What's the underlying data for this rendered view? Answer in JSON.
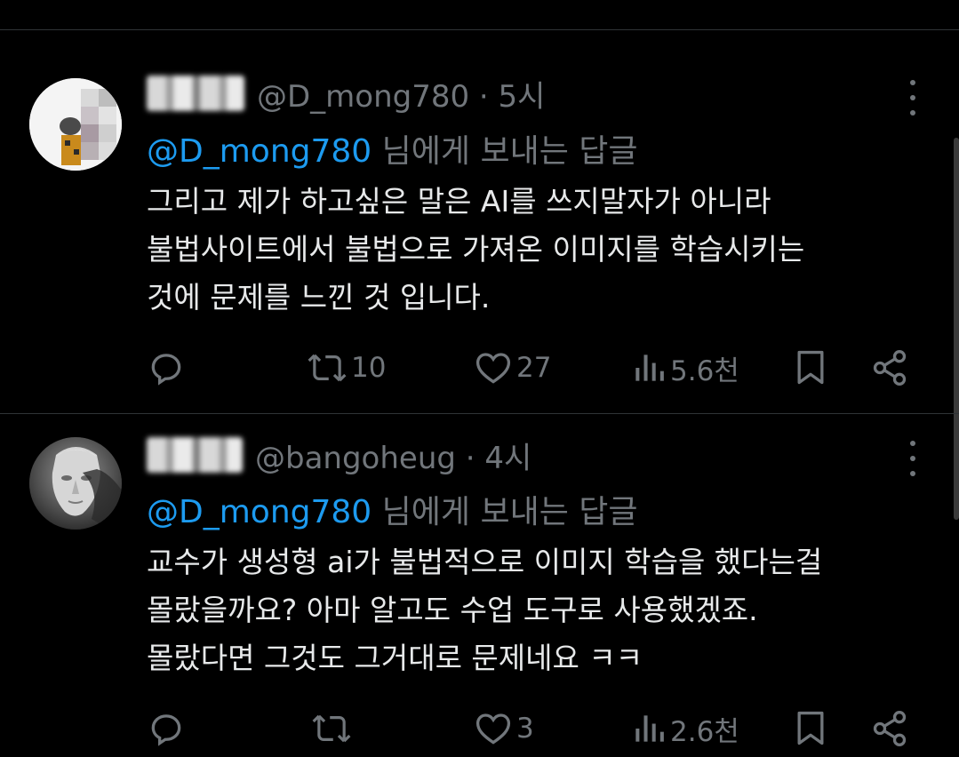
{
  "tweets": [
    {
      "handle_meta": "@D_mong780 · 5시",
      "reply_prefix": "@D_mong780",
      "reply_suffix": " 님에게 보내는 답글",
      "text": "그리고 제가 하고싶은 말은 AI를 쓰지말자가 아니라\n불법사이트에서 불법으로 가져온 이미지를 학습시키는\n것에 문제를 느낀 것 입니다.",
      "retweets": "10",
      "likes": "27",
      "views": "5.6천"
    },
    {
      "handle_meta": "@bangoheug · 4시",
      "reply_prefix": "@D_mong780",
      "reply_suffix": " 님에게 보내는 답글",
      "text": "교수가 생성형 ai가 불법적으로 이미지 학습을 했다는걸\n몰랐을까요? 아마 알고도 수업 도구로 사용했겠죠.\n몰랐다면 그것도 그거대로 문제네요 ㅋㅋ",
      "retweets": "",
      "likes": "3",
      "views": "2.6천"
    }
  ],
  "colors": {
    "background": "#000000",
    "text": "#e7e9ea",
    "secondary": "#71767b",
    "mention": "#1d9bf0",
    "divider": "#2f3336"
  },
  "icons": [
    "reply-icon",
    "retweet-icon",
    "like-icon",
    "views-icon",
    "bookmark-icon",
    "share-icon",
    "more-icon"
  ]
}
